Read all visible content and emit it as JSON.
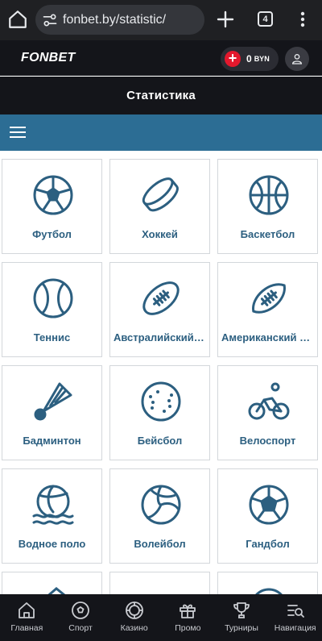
{
  "browser": {
    "url": "fonbet.by/statistic/",
    "tab_count": "4"
  },
  "header": {
    "logo": "FONBET",
    "balance_amount": "0",
    "balance_currency": "BYN"
  },
  "page": {
    "title": "Статистика"
  },
  "sports": [
    {
      "label": "Футбол",
      "icon": "soccer-ball-icon"
    },
    {
      "label": "Хоккей",
      "icon": "hockey-puck-icon"
    },
    {
      "label": "Баскетбол",
      "icon": "basketball-icon"
    },
    {
      "label": "Теннис",
      "icon": "tennis-ball-icon"
    },
    {
      "label": "Австралийский футбол",
      "icon": "australian-football-icon"
    },
    {
      "label": "Американский футбол",
      "icon": "american-football-icon"
    },
    {
      "label": "Бадминтон",
      "icon": "shuttlecock-icon"
    },
    {
      "label": "Бейсбол",
      "icon": "baseball-icon"
    },
    {
      "label": "Велоспорт",
      "icon": "cyclist-icon"
    },
    {
      "label": "Водное поло",
      "icon": "water-polo-icon"
    },
    {
      "label": "Волейбол",
      "icon": "volleyball-icon"
    },
    {
      "label": "Гандбол",
      "icon": "handball-icon"
    }
  ],
  "bottom_nav": [
    {
      "label": "Главная",
      "icon": "home-icon"
    },
    {
      "label": "Спорт",
      "icon": "sport-ball-icon"
    },
    {
      "label": "Казино",
      "icon": "casino-chip-icon"
    },
    {
      "label": "Промо",
      "icon": "gift-icon"
    },
    {
      "label": "Турниры",
      "icon": "trophy-icon"
    },
    {
      "label": "Навигация",
      "icon": "navigation-search-icon"
    }
  ],
  "colors": {
    "accent": "#2c6d94",
    "icon": "#2c5f80",
    "dark_bg": "#14151a",
    "deposit_red": "#e3182d"
  }
}
